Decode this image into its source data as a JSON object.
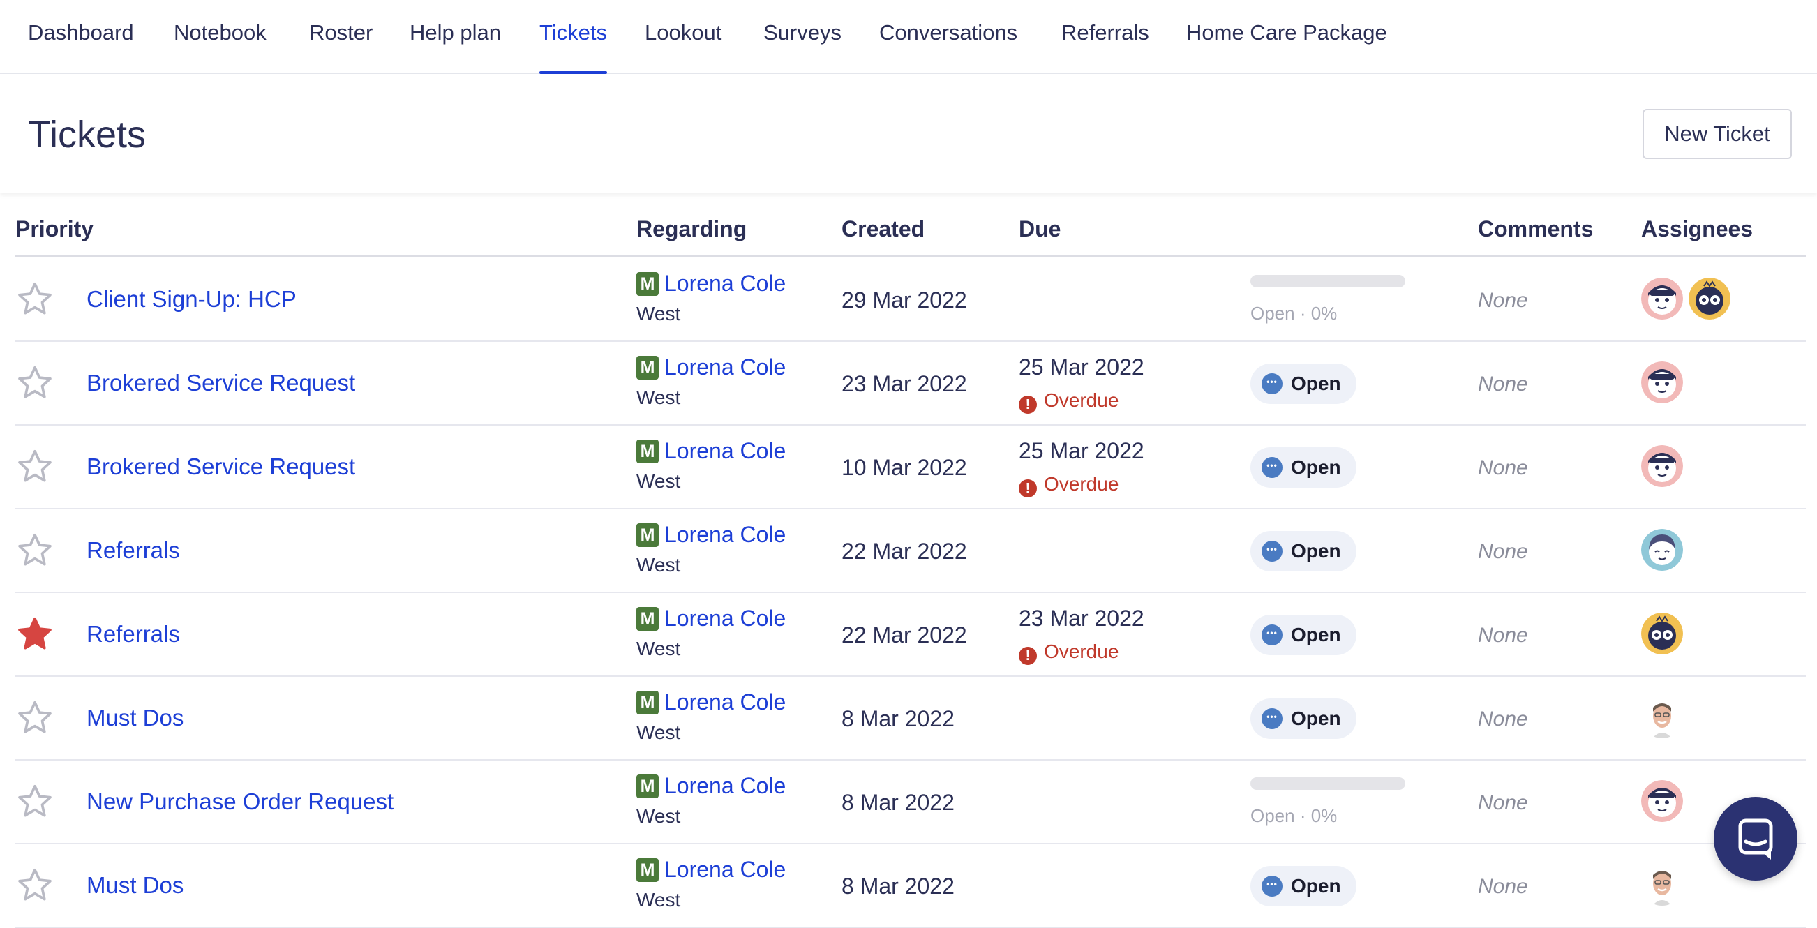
{
  "nav": {
    "tabs": [
      {
        "label": "Dashboard"
      },
      {
        "label": "Notebook"
      },
      {
        "label": "Roster"
      },
      {
        "label": "Help plan"
      },
      {
        "label": "Tickets"
      },
      {
        "label": "Lookout"
      },
      {
        "label": "Surveys"
      },
      {
        "label": "Conversations"
      },
      {
        "label": "Referrals"
      },
      {
        "label": "Home Care Package"
      }
    ],
    "active": "Tickets"
  },
  "header": {
    "title": "Tickets",
    "new_ticket_label": "New Ticket"
  },
  "table": {
    "columns": {
      "priority": "Priority",
      "regarding": "Regarding",
      "created": "Created",
      "due": "Due",
      "comments": "Comments",
      "assignees": "Assignees"
    },
    "rows": [
      {
        "starred": false,
        "title": "Client Sign-Up: HCP",
        "badge": "M",
        "client": "Lorena Cole",
        "region": "West",
        "created": "29 Mar 2022",
        "due": "",
        "overdue": "",
        "status_type": "progress",
        "status": "Open · 0%",
        "progress": 0,
        "comments": "None",
        "assignees": [
          "face-pink",
          "face-yellow"
        ]
      },
      {
        "starred": false,
        "title": "Brokered Service Request",
        "badge": "M",
        "client": "Lorena Cole",
        "region": "West",
        "created": "23 Mar 2022",
        "due": "25 Mar 2022",
        "overdue": "Overdue",
        "status_type": "pill",
        "status": "Open",
        "comments": "None",
        "assignees": [
          "face-pink"
        ]
      },
      {
        "starred": false,
        "title": "Brokered Service Request",
        "badge": "M",
        "client": "Lorena Cole",
        "region": "West",
        "created": "10 Mar 2022",
        "due": "25 Mar 2022",
        "overdue": "Overdue",
        "status_type": "pill",
        "status": "Open",
        "comments": "None",
        "assignees": [
          "face-pink"
        ]
      },
      {
        "starred": false,
        "title": "Referrals",
        "badge": "M",
        "client": "Lorena Cole",
        "region": "West",
        "created": "22 Mar 2022",
        "due": "",
        "overdue": "",
        "status_type": "pill",
        "status": "Open",
        "comments": "None",
        "assignees": [
          "face-blue"
        ]
      },
      {
        "starred": true,
        "title": "Referrals",
        "badge": "M",
        "client": "Lorena Cole",
        "region": "West",
        "created": "22 Mar 2022",
        "due": "23 Mar 2022",
        "overdue": "Overdue",
        "status_type": "pill",
        "status": "Open",
        "comments": "None",
        "assignees": [
          "face-yellow"
        ]
      },
      {
        "starred": false,
        "title": "Must Dos",
        "badge": "M",
        "client": "Lorena Cole",
        "region": "West",
        "created": "8 Mar 2022",
        "due": "",
        "overdue": "",
        "status_type": "pill",
        "status": "Open",
        "comments": "None",
        "assignees": [
          "photo-man"
        ]
      },
      {
        "starred": false,
        "title": "New Purchase Order Request",
        "badge": "M",
        "client": "Lorena Cole",
        "region": "West",
        "created": "8 Mar 2022",
        "due": "",
        "overdue": "",
        "status_type": "progress",
        "status": "Open · 0%",
        "progress": 0,
        "comments": "None",
        "assignees": [
          "face-pink"
        ]
      },
      {
        "starred": false,
        "title": "Must Dos",
        "badge": "M",
        "client": "Lorena Cole",
        "region": "West",
        "created": "8 Mar 2022",
        "due": "",
        "overdue": "",
        "status_type": "pill",
        "status": "Open",
        "comments": "None",
        "assignees": [
          "photo-man"
        ]
      }
    ]
  },
  "colors": {
    "accent": "#1d3fd6",
    "text": "#2b2f55",
    "overdue": "#c0392b",
    "star_filled": "#d64541",
    "star_empty": "#b9bac4",
    "badge": "#4b7a3a",
    "chat_launcher": "#2b3272"
  },
  "icons": {
    "priority": "star-icon",
    "overdue": "exclamation-circle-icon",
    "status": "dots-circle-icon",
    "chat": "chat-bubble-icon"
  }
}
